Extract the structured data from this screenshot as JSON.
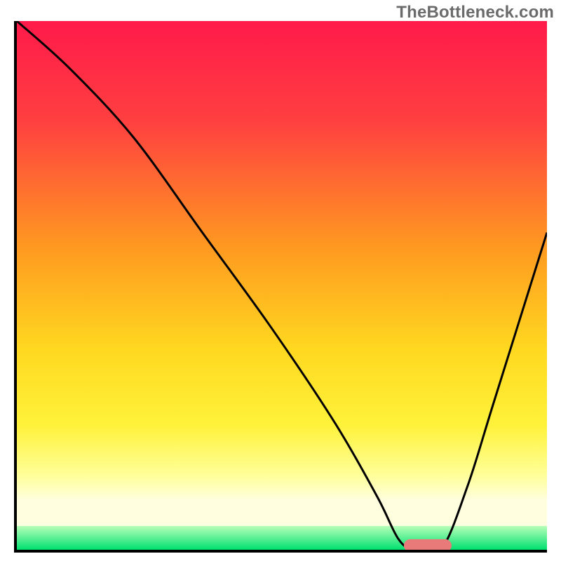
{
  "watermark": "TheBottleneck.com",
  "chart_data": {
    "type": "line",
    "title": "",
    "xlabel": "",
    "ylabel": "",
    "x_range": [
      0,
      100
    ],
    "y_range": [
      0,
      100
    ],
    "axes_visible": {
      "ticks": false,
      "labels": false,
      "grid": false
    },
    "background": {
      "type": "vertical_gradient_with_bottom_band",
      "stops": [
        {
          "pos": 0.0,
          "color": "#ff1a4a"
        },
        {
          "pos": 0.2,
          "color": "#ff4040"
        },
        {
          "pos": 0.45,
          "color": "#ff9a20"
        },
        {
          "pos": 0.65,
          "color": "#ffd820"
        },
        {
          "pos": 0.8,
          "color": "#fff23a"
        },
        {
          "pos": 0.9,
          "color": "#ffff9a"
        },
        {
          "pos": 0.95,
          "color": "#ffffe0"
        }
      ],
      "bottom_band": {
        "from": 0.955,
        "to": 1.0,
        "color_top": "#b8ffb8",
        "color_bottom": "#00e070"
      }
    },
    "series": [
      {
        "name": "curve",
        "stroke": "#000000",
        "stroke_width": 3,
        "x": [
          0,
          10,
          22,
          35,
          48,
          60,
          68,
          72,
          75,
          80,
          85,
          90,
          100
        ],
        "y": [
          100,
          91,
          78,
          60,
          42,
          24,
          10,
          2,
          0,
          0,
          12,
          28,
          60
        ]
      }
    ],
    "markers": [
      {
        "name": "optimum-marker",
        "shape": "rounded_bar",
        "x_center": 77.5,
        "y_center": 0.8,
        "width": 9,
        "height": 2.4,
        "fill": "#e87a7a"
      }
    ]
  }
}
